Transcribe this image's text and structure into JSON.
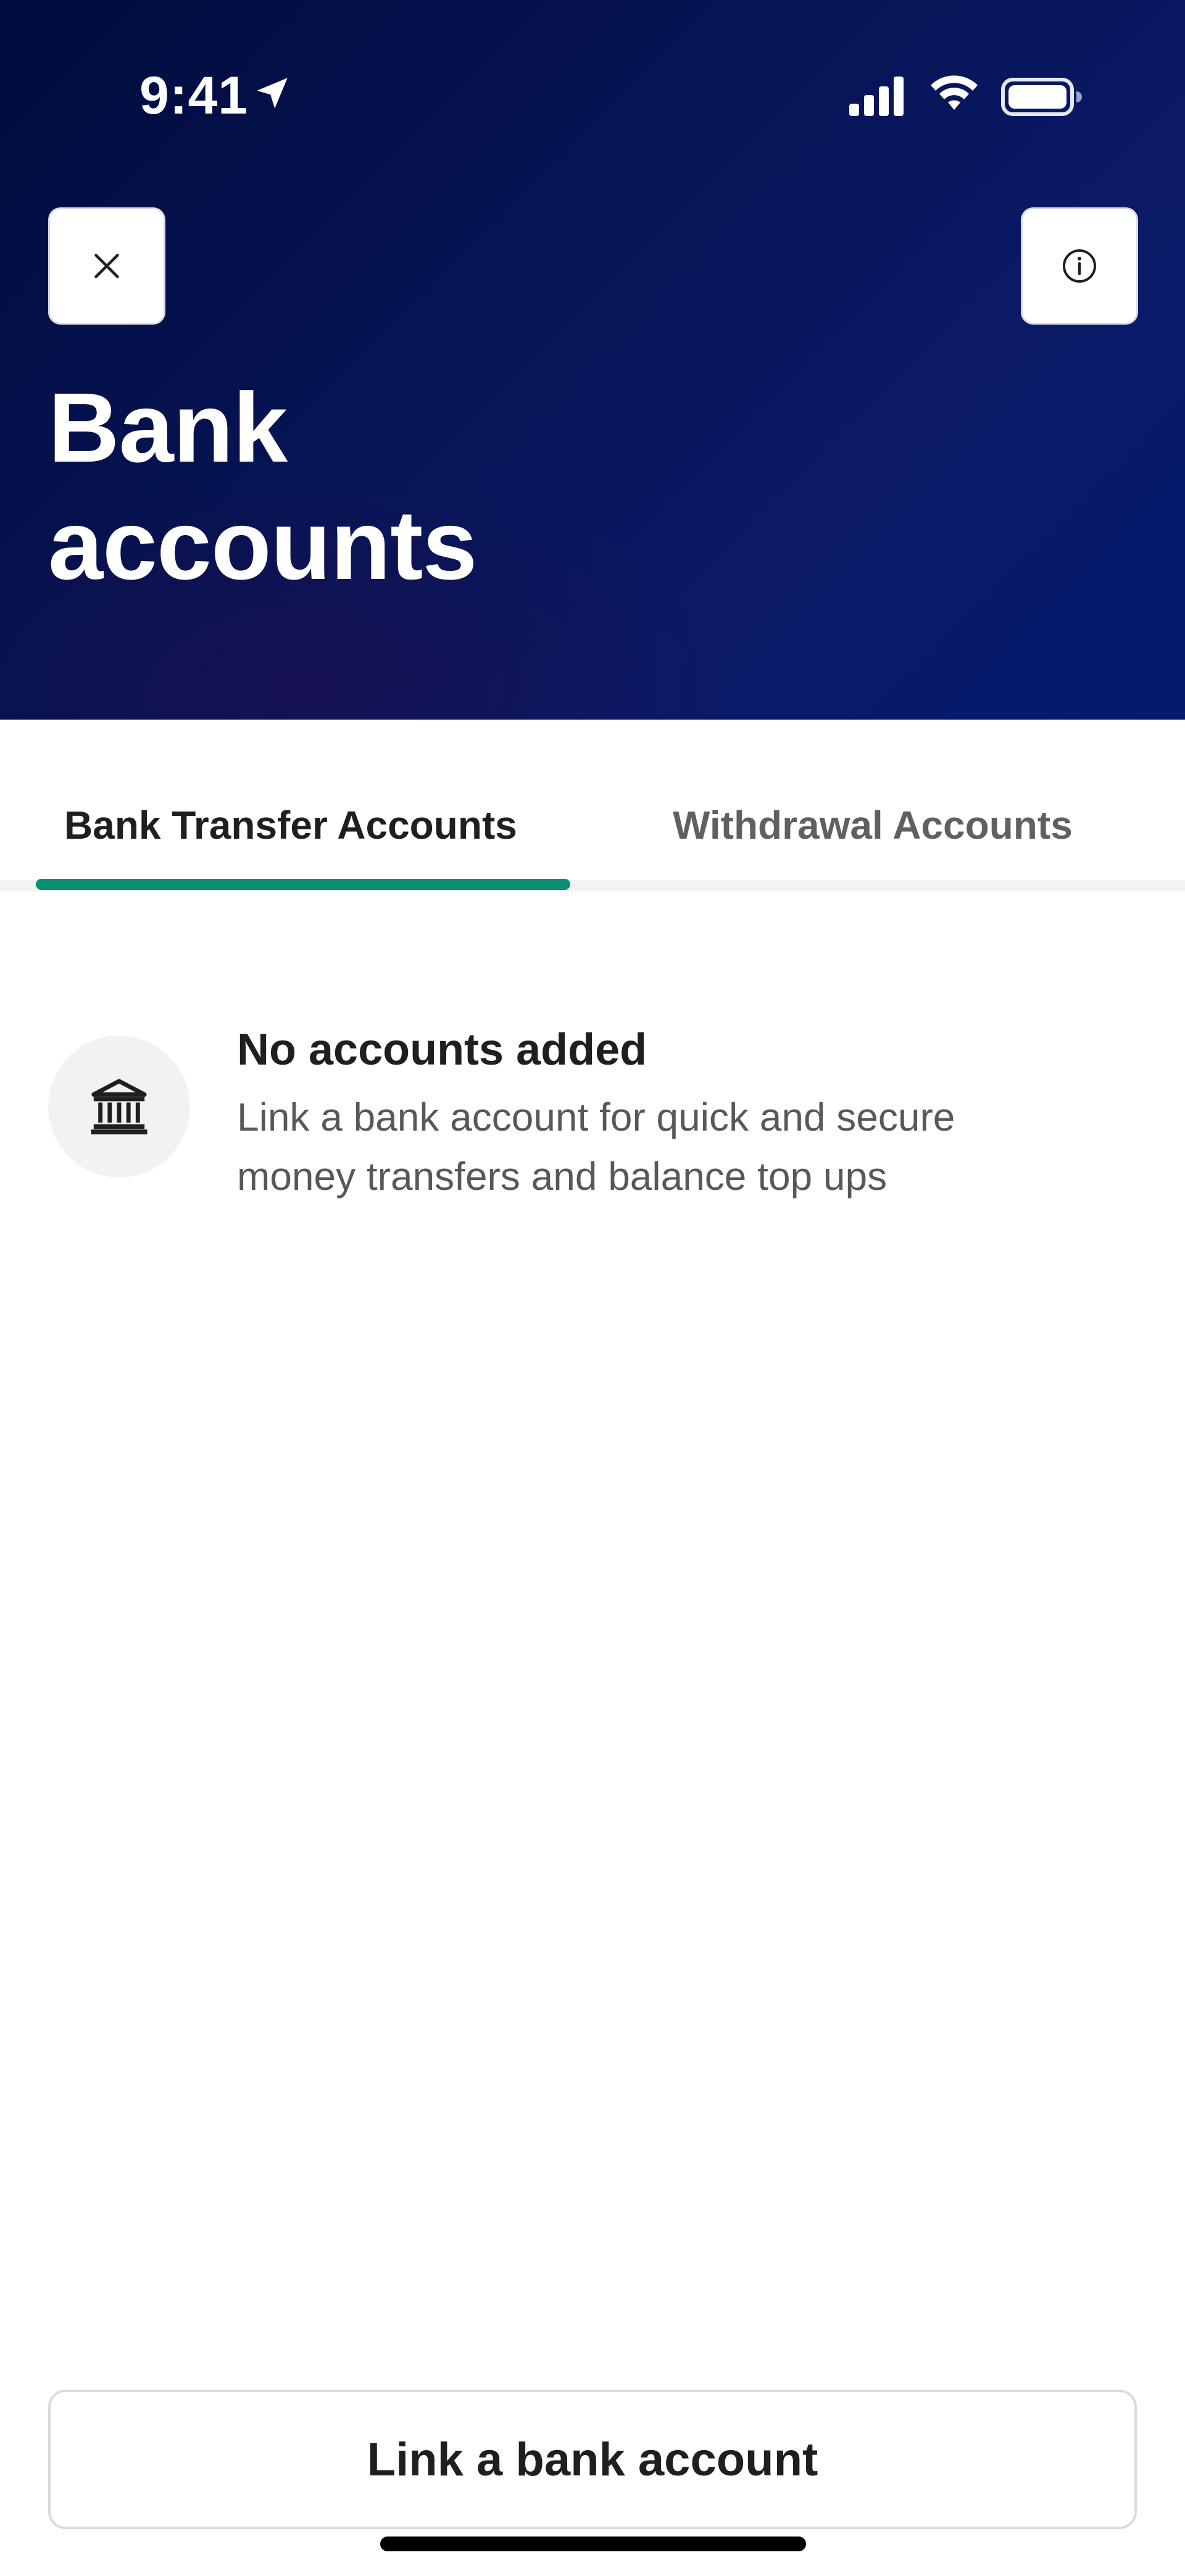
{
  "status_bar": {
    "time": "9:41",
    "icons": [
      "location-arrow-icon",
      "cellular-signal-icon",
      "wifi-icon",
      "battery-icon"
    ]
  },
  "header": {
    "close_icon": "close-icon",
    "info_icon": "info-icon",
    "title_line1": "Bank",
    "title_line2": "accounts",
    "gradient_colors": [
      "#020b3d",
      "#0a1a66"
    ]
  },
  "tabs": [
    {
      "label": "Bank Transfer Accounts",
      "selected": true
    },
    {
      "label": "Withdrawal Accounts",
      "selected": false
    }
  ],
  "empty_state": {
    "icon": "bank-icon",
    "title": "No accounts added",
    "description": "Link a bank account for quick and secure money transfers and balance top ups"
  },
  "footer": {
    "primary_button_label": "Link a bank account"
  },
  "colors": {
    "accent": "#0a8f72",
    "header_bg": "#061556",
    "text_primary": "#1f1f1f",
    "text_secondary": "#55585c"
  }
}
